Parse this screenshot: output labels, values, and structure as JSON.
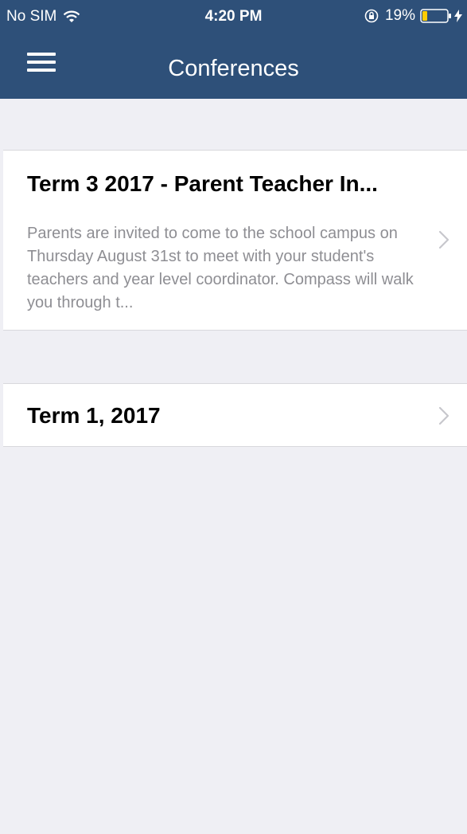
{
  "status_bar": {
    "carrier": "No SIM",
    "time": "4:20 PM",
    "battery_percent": "19%",
    "battery_level": 0.19,
    "icons": [
      "wifi-icon",
      "orientation-lock-icon",
      "battery-icon",
      "charging-icon"
    ]
  },
  "nav": {
    "title": "Conferences",
    "menu_icon": "hamburger-menu-icon"
  },
  "conferences": [
    {
      "title": "Term 3 2017 - Parent Teacher In...",
      "description": "Parents are invited to come to the school campus on Thursday August 31st to meet with your student's teachers and year level coordinator. Compass will walk you through t..."
    },
    {
      "title": "Term 1, 2017",
      "description": ""
    }
  ],
  "colors": {
    "nav_background": "#2e5079",
    "page_background": "#efeff4",
    "card_background": "#ffffff",
    "description_text": "#8e8e93",
    "chevron": "#c7c7cc",
    "battery_fill": "#ffcc00"
  }
}
